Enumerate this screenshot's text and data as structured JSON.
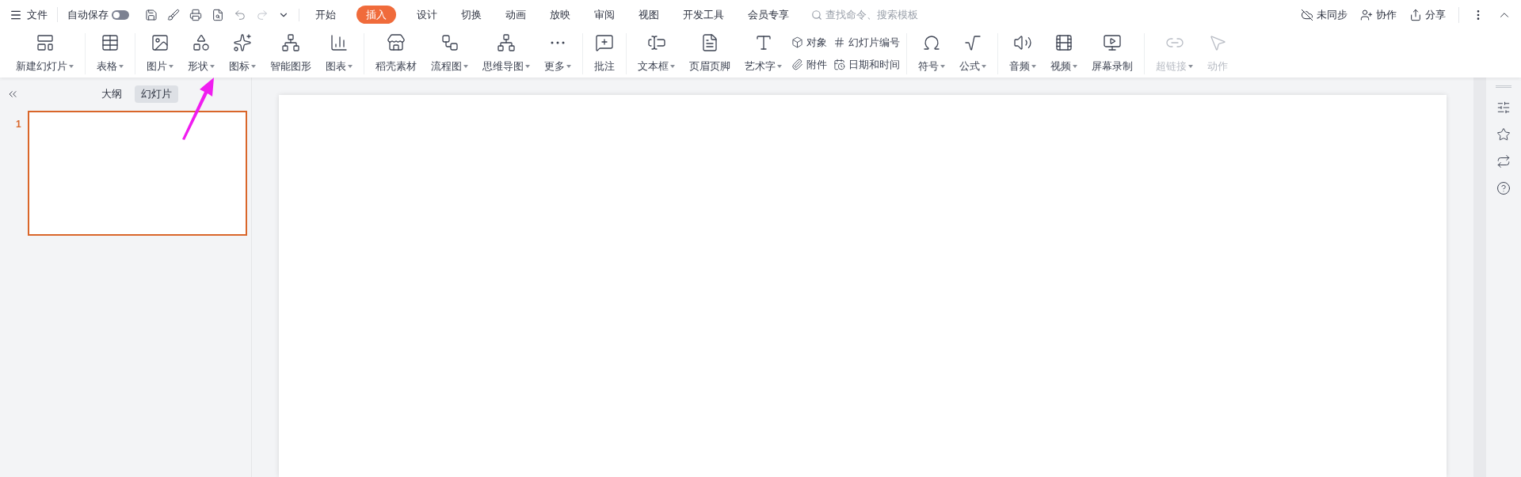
{
  "title_bar": {
    "menu": "文件",
    "autosave": {
      "label": "自动保存",
      "on": false
    },
    "tabs": [
      {
        "label": "开始",
        "selected": false
      },
      {
        "label": "插入",
        "selected": true
      },
      {
        "label": "设计",
        "selected": false
      },
      {
        "label": "切换",
        "selected": false
      },
      {
        "label": "动画",
        "selected": false
      },
      {
        "label": "放映",
        "selected": false
      },
      {
        "label": "审阅",
        "selected": false
      },
      {
        "label": "视图",
        "selected": false
      },
      {
        "label": "开发工具",
        "selected": false
      },
      {
        "label": "会员专享",
        "selected": false
      }
    ],
    "search": {
      "placeholder": "查找命令、搜索模板"
    },
    "actions": [
      "未同步",
      "协作",
      "分享"
    ]
  },
  "ribbon": {
    "groups": [
      [
        {
          "kind": "big",
          "label": "新建幻灯片",
          "dropdown": true,
          "disabled": false
        }
      ],
      [
        {
          "kind": "big",
          "label": "表格",
          "dropdown": true,
          "disabled": false
        }
      ],
      [
        {
          "kind": "big",
          "label": "图片",
          "dropdown": true,
          "disabled": false
        },
        {
          "kind": "big",
          "label": "形状",
          "dropdown": true,
          "disabled": false
        },
        {
          "kind": "big",
          "label": "图标",
          "dropdown": true,
          "disabled": false
        },
        {
          "kind": "big",
          "label": "智能图形",
          "dropdown": false,
          "disabled": false
        },
        {
          "kind": "big",
          "label": "图表",
          "dropdown": true,
          "disabled": false
        }
      ],
      [
        {
          "kind": "big",
          "label": "稻壳素材",
          "dropdown": false,
          "disabled": false
        },
        {
          "kind": "big",
          "label": "流程图",
          "dropdown": true,
          "disabled": false
        },
        {
          "kind": "big",
          "label": "思维导图",
          "dropdown": true,
          "disabled": false
        },
        {
          "kind": "big",
          "label": "更多",
          "dropdown": true,
          "disabled": false
        }
      ],
      [
        {
          "kind": "big",
          "label": "批注",
          "dropdown": false,
          "disabled": false
        }
      ],
      [
        {
          "kind": "big",
          "label": "文本框",
          "dropdown": true,
          "disabled": false
        },
        {
          "kind": "big",
          "label": "页眉页脚",
          "dropdown": false,
          "disabled": false
        },
        {
          "kind": "big",
          "label": "艺术字",
          "dropdown": true,
          "disabled": false
        },
        {
          "kind": "small",
          "label": "对象",
          "disabled": false
        },
        {
          "kind": "small",
          "label": "附件",
          "disabled": false
        },
        {
          "kind": "small",
          "label": "幻灯片编号",
          "disabled": false
        },
        {
          "kind": "small",
          "label": "日期和时间",
          "disabled": false
        }
      ],
      [
        {
          "kind": "big",
          "label": "符号",
          "dropdown": true,
          "disabled": false
        },
        {
          "kind": "big",
          "label": "公式",
          "dropdown": true,
          "disabled": false
        }
      ],
      [
        {
          "kind": "big",
          "label": "音频",
          "dropdown": true,
          "disabled": false
        },
        {
          "kind": "big",
          "label": "视频",
          "dropdown": true,
          "disabled": false
        },
        {
          "kind": "big",
          "label": "屏幕录制",
          "dropdown": false,
          "disabled": false
        }
      ],
      [
        {
          "kind": "big",
          "label": "超链接",
          "dropdown": true,
          "disabled": true
        },
        {
          "kind": "big",
          "label": "动作",
          "dropdown": false,
          "disabled": true
        }
      ]
    ]
  },
  "slide_panel": {
    "tabs": [
      {
        "label": "大纲",
        "selected": false
      },
      {
        "label": "幻灯片",
        "selected": true
      }
    ],
    "slides": [
      {
        "number": "1",
        "selected": true
      }
    ]
  }
}
